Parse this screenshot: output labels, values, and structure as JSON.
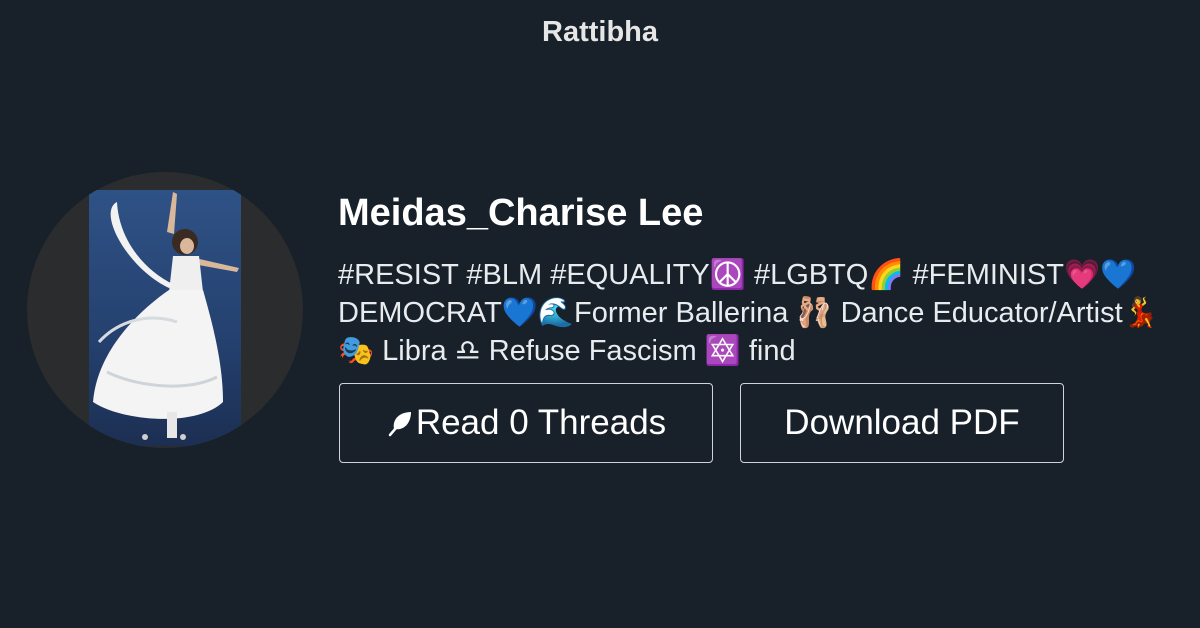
{
  "brand": {
    "name": "Rattibha"
  },
  "profile": {
    "name": "Meidas_Charise Lee",
    "bio": "#RESIST #BLM #EQUALITY☮️ #LGBTQ🌈 #FEMINIST💗💙DEMOCRAT💙🌊Former Ballerina 🩰 Dance Educator/Artist💃🎭 Libra ♎ Refuse Fascism 🔯 find",
    "avatar_alt": "photo of a dancer in a white dress"
  },
  "actions": {
    "threads_label": "Read 0 Threads",
    "pdf_label": "Download PDF",
    "threads_icon": "feather-icon"
  },
  "colors": {
    "background": "#18202a",
    "text": "#ffffff",
    "button_border": "#d0d4d8"
  }
}
